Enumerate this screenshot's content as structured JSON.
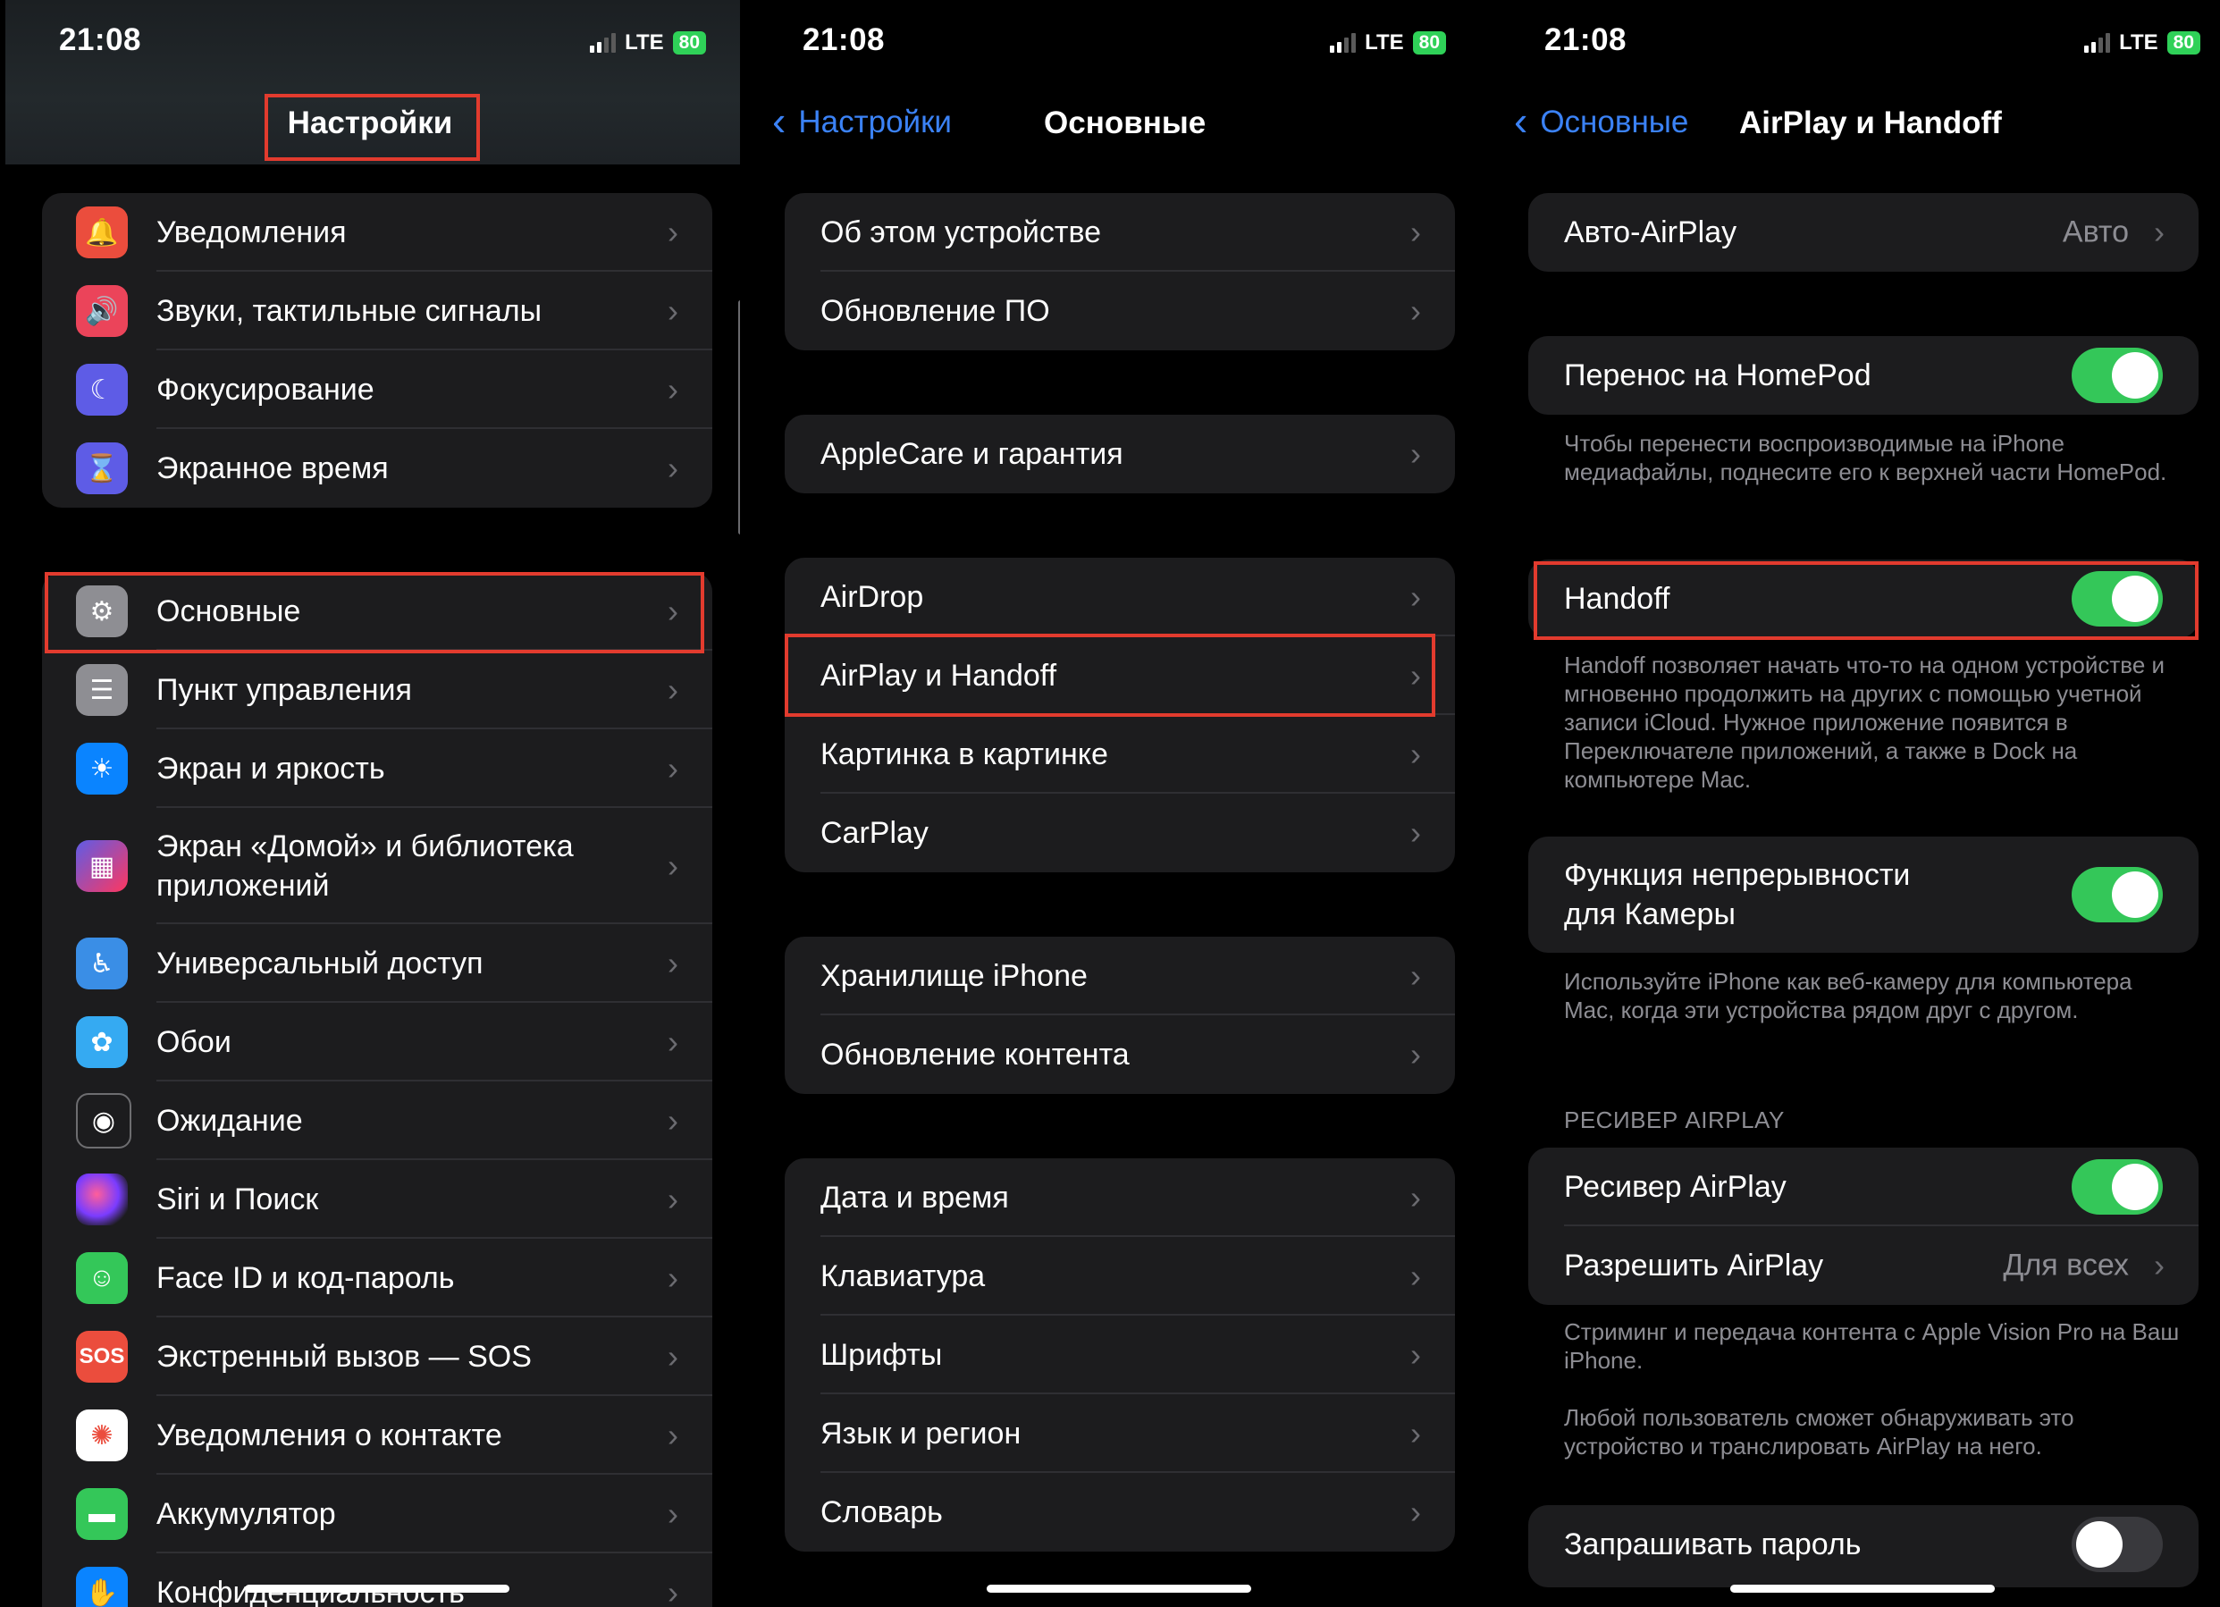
{
  "status": {
    "time": "21:08",
    "network": "LTE",
    "battery": "80"
  },
  "panel1": {
    "title": "Настройки",
    "group1": [
      {
        "label": "Уведомления",
        "icon": "bell-icon",
        "glyph": "🔔",
        "color": "g-red"
      },
      {
        "label": "Звуки, тактильные сигналы",
        "icon": "speaker-icon",
        "glyph": "🔊",
        "color": "g-pink"
      },
      {
        "label": "Фокусирование",
        "icon": "moon-icon",
        "glyph": "☾",
        "color": "g-indigo"
      },
      {
        "label": "Экранное время",
        "icon": "hourglass-icon",
        "glyph": "⌛",
        "color": "g-purple"
      }
    ],
    "group2": [
      {
        "label": "Основные",
        "icon": "gear-icon",
        "glyph": "⚙",
        "color": "g-gray"
      },
      {
        "label": "Пункт управления",
        "icon": "switches-icon",
        "glyph": "☰",
        "color": "g-gray"
      },
      {
        "label": "Экран и яркость",
        "icon": "sun-icon",
        "glyph": "☀",
        "color": "g-blue"
      },
      {
        "label": "Экран «Домой» и библиотека приложений",
        "icon": "home-grid-icon",
        "glyph": "▦",
        "color": "g-multi",
        "tall": true
      },
      {
        "label": "Универсальный доступ",
        "icon": "accessibility-icon",
        "glyph": "♿",
        "color": "g-teal"
      },
      {
        "label": "Обои",
        "icon": "flower-icon",
        "glyph": "✿",
        "color": "g-cyan"
      },
      {
        "label": "Ожидание",
        "icon": "standby-icon",
        "glyph": "◉",
        "color": "g-black"
      },
      {
        "label": "Siri и Поиск",
        "icon": "siri-icon",
        "glyph": "",
        "color": "g-siri"
      },
      {
        "label": "Face ID и код-пароль",
        "icon": "faceid-icon",
        "glyph": "☺",
        "color": "g-green"
      },
      {
        "label": "Экстренный вызов — SOS",
        "icon": "sos-icon",
        "glyph": "SOS",
        "color": "g-sos"
      },
      {
        "label": "Уведомления о контакте",
        "icon": "exposure-icon",
        "glyph": "✺",
        "color": "g-white"
      },
      {
        "label": "Аккумулятор",
        "icon": "battery-icon",
        "glyph": "▬",
        "color": "g-batt"
      },
      {
        "label": "Конфиденциальность",
        "icon": "privacy-hand-icon",
        "glyph": "✋",
        "color": "g-blue"
      }
    ]
  },
  "panel2": {
    "back": "Настройки",
    "title": "Основные",
    "groups": [
      [
        "Об этом устройстве",
        "Обновление ПО"
      ],
      [
        "AppleCare и гарантия"
      ],
      [
        "AirDrop",
        "AirPlay и Handoff",
        "Картинка в картинке",
        "CarPlay"
      ],
      [
        "Хранилище iPhone",
        "Обновление контента"
      ],
      [
        "Дата и время",
        "Клавиатура",
        "Шрифты",
        "Язык и регион",
        "Словарь"
      ]
    ]
  },
  "panel3": {
    "back": "Основные",
    "title": "AirPlay и Handoff",
    "auto_airplay": {
      "label": "Авто-AirPlay",
      "value": "Авто"
    },
    "homepod": {
      "label": "Перенос на HomePod",
      "on": true
    },
    "homepod_note": "Чтобы перенести воспроизводимые на iPhone медиафайлы, поднесите его к верхней части HomePod.",
    "handoff": {
      "label": "Handoff",
      "on": true
    },
    "handoff_note": "Handoff позволяет начать что-то на одном устройстве и мгновенно продолжить на других с помощью учетной записи iCloud. Нужное приложение появится в Переключателе приложений, а также в Dock на компьютере Mac.",
    "continuity": {
      "label": "Функция непрерывности для Камеры",
      "on": true
    },
    "continuity_note": "Используйте iPhone как веб-камеру для компьютера Mac, когда эти устройства рядом друг с другом.",
    "receiver_header": "РЕСИВЕР AIRPLAY",
    "receiver": {
      "label": "Ресивер AirPlay",
      "on": true
    },
    "allow": {
      "label": "Разрешить AirPlay",
      "value": "Для всех"
    },
    "receiver_note1": "Стриминг и передача контента с Apple Vision Pro на Ваш iPhone.",
    "receiver_note2": "Любой пользователь сможет обнаруживать это устройство и транслировать AirPlay на него.",
    "password": {
      "label": "Запрашивать пароль",
      "on": false
    }
  }
}
